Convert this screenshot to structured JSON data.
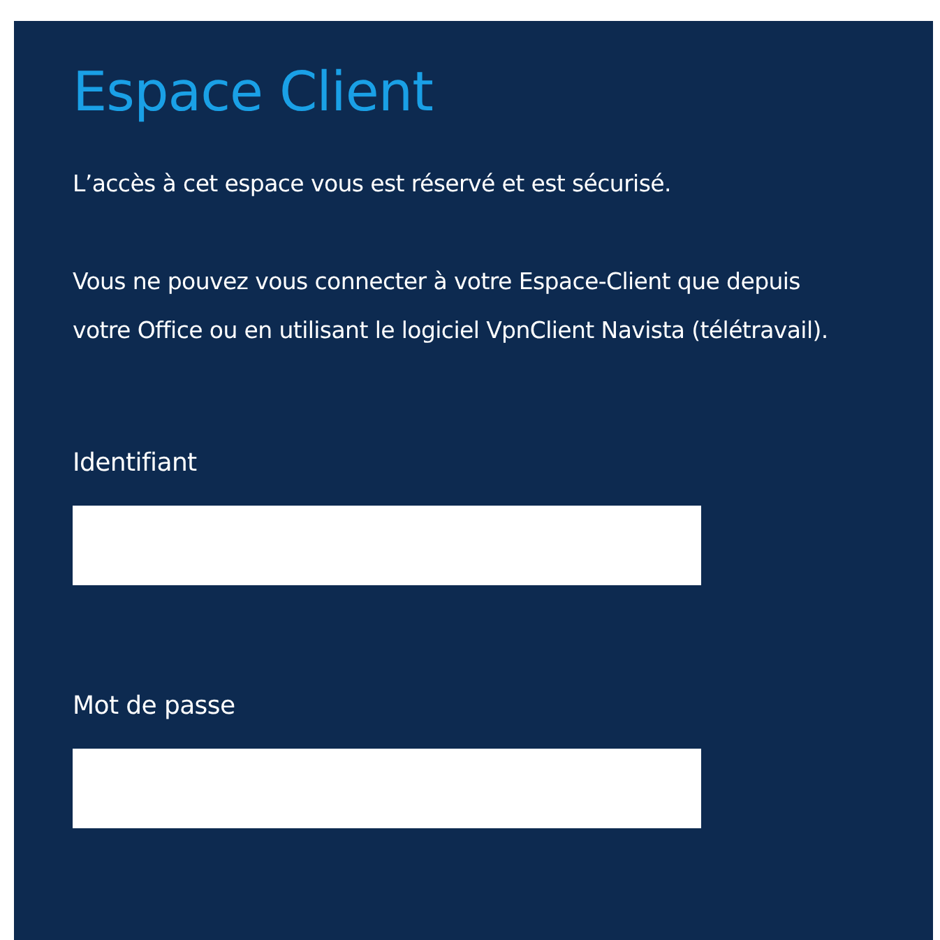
{
  "title": "Espace Client",
  "paragraphs": [
    "L’accès à cet espace vous est réservé et est sécurisé.",
    "Vous ne pouvez vous connecter à votre Espace-Client que depuis votre Office ou en utilisant le logiciel VpnClient Navista (télétravail)."
  ],
  "fields": [
    {
      "label": "Identifiant"
    },
    {
      "label": "Mot de passe"
    }
  ]
}
